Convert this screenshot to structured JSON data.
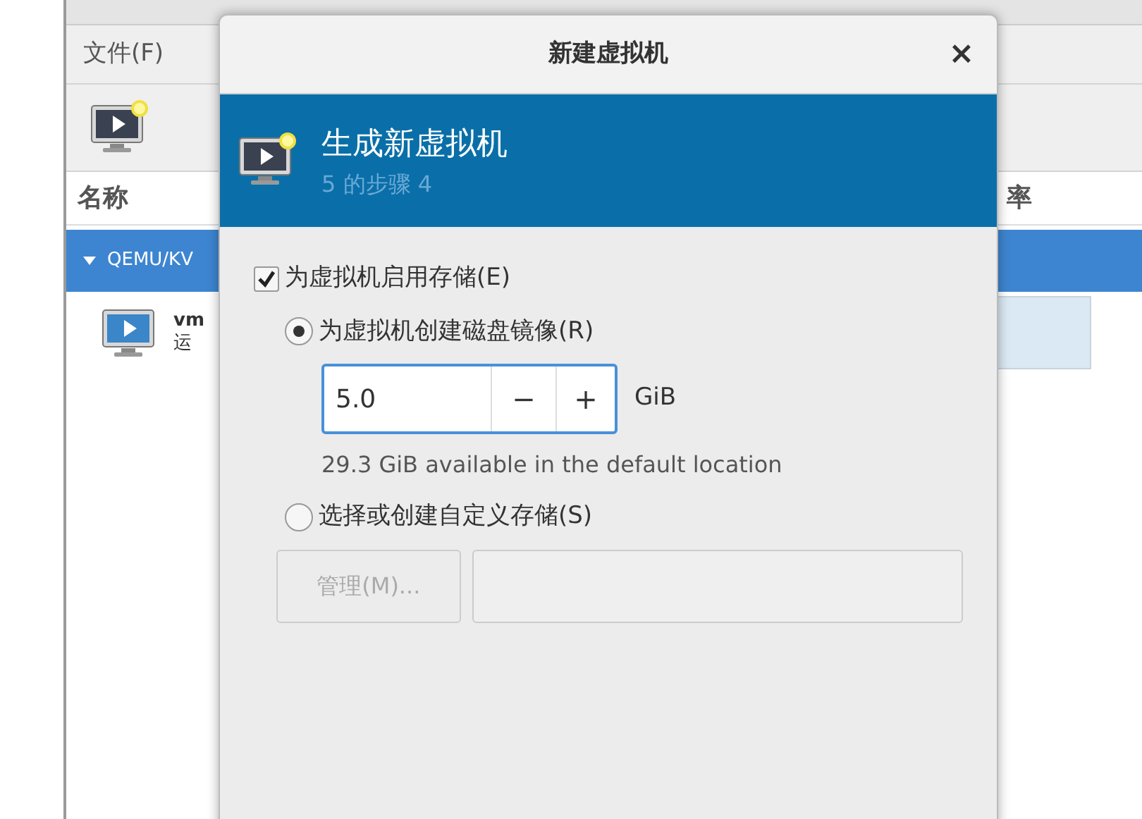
{
  "main_window": {
    "menu": [
      "文件(F)"
    ],
    "columns": [
      "名称",
      "率"
    ],
    "groups": [
      {
        "label": "QEMU/KV",
        "expanded": true,
        "selected": true,
        "rows": [
          {
            "name": "vm",
            "status": "运"
          }
        ]
      }
    ]
  },
  "dialog": {
    "title": "新建虚拟机",
    "close": "×",
    "banner": {
      "title": "生成新虚拟机",
      "step": "5 的步骤 4"
    },
    "enable_storage": {
      "label": "为虚拟机启用存储(E)",
      "checked": true
    },
    "options": [
      {
        "label": "为虚拟机创建磁盘镜像(R)",
        "selected": true
      },
      {
        "label": "选择或创建自定义存储(S)",
        "selected": false
      }
    ],
    "size": {
      "value": "5.0",
      "minus": "−",
      "plus": "+",
      "unit": "GiB"
    },
    "available": "29.3 GiB available in the default location",
    "manage": {
      "label": "管理(M)...",
      "disabled": true
    },
    "path_field": {
      "disabled": true
    }
  }
}
